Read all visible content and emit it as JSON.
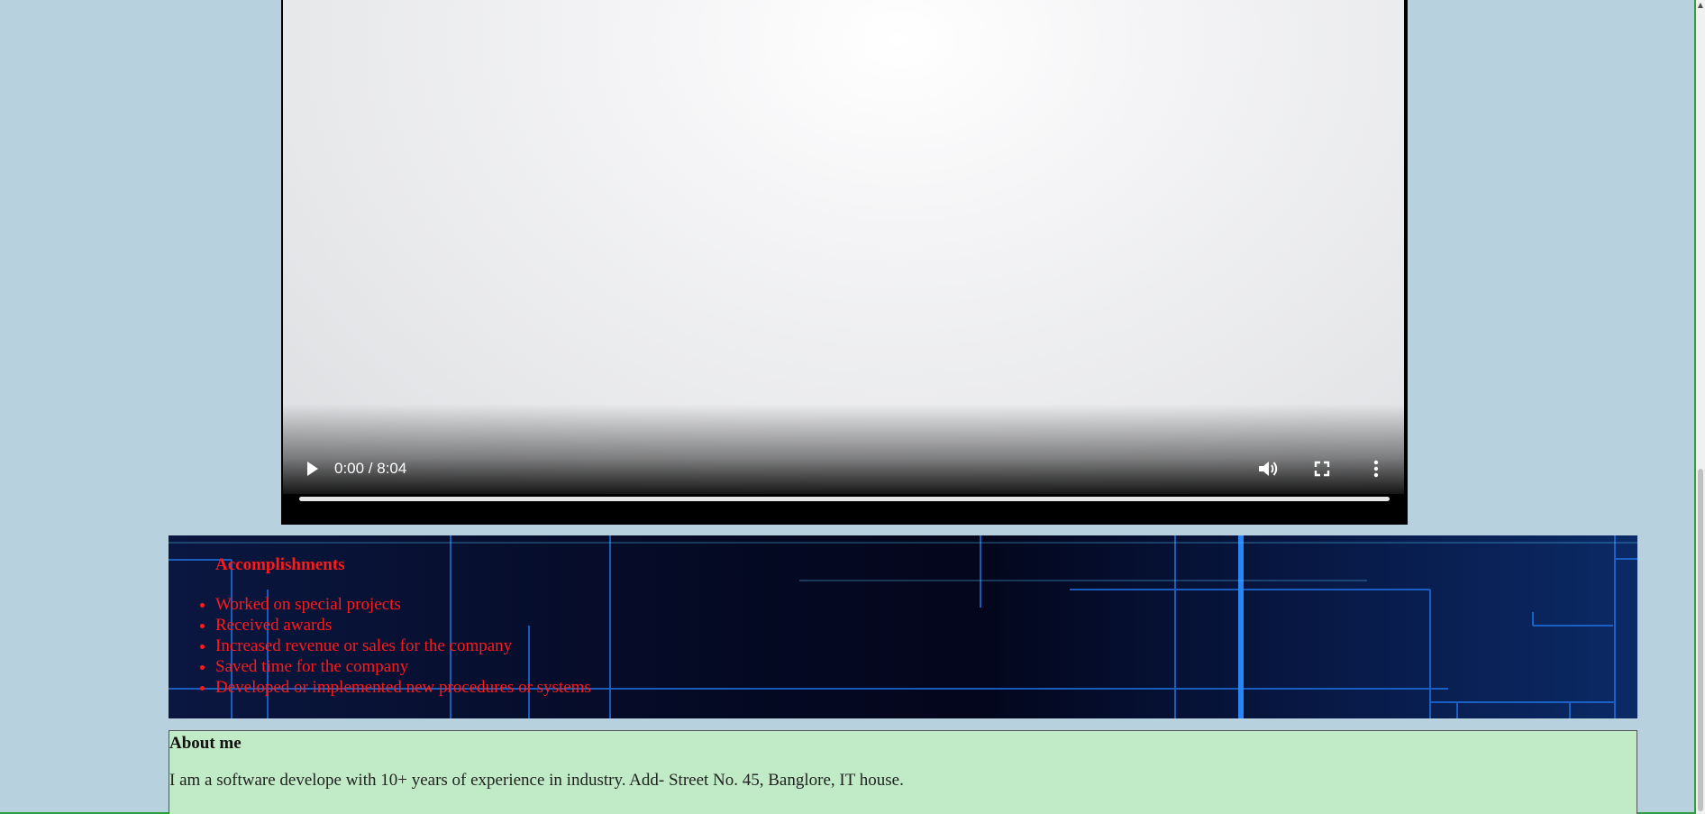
{
  "video": {
    "time": "0:00 / 8:04",
    "play_icon": "play-icon",
    "volume_icon": "volume-icon",
    "fullscreen_icon": "fullscreen-icon",
    "more_icon": "more-vertical-icon",
    "progress": 0
  },
  "accomplishments": {
    "heading": "Accomplishments",
    "items": [
      "Worked on special projects",
      "Received awards",
      "Increased revenue or sales for the company",
      "Saved time for the company",
      "Developed or implemented new procedures or systems"
    ],
    "text_color": "#ff1a1a"
  },
  "about": {
    "heading": "About me",
    "text": "I am a software develope with 10+ years of experience in industry. Add- Street No. 45, Banglore, IT house.",
    "background": "#c1ebc6"
  },
  "page": {
    "background": "#b7d1df"
  }
}
